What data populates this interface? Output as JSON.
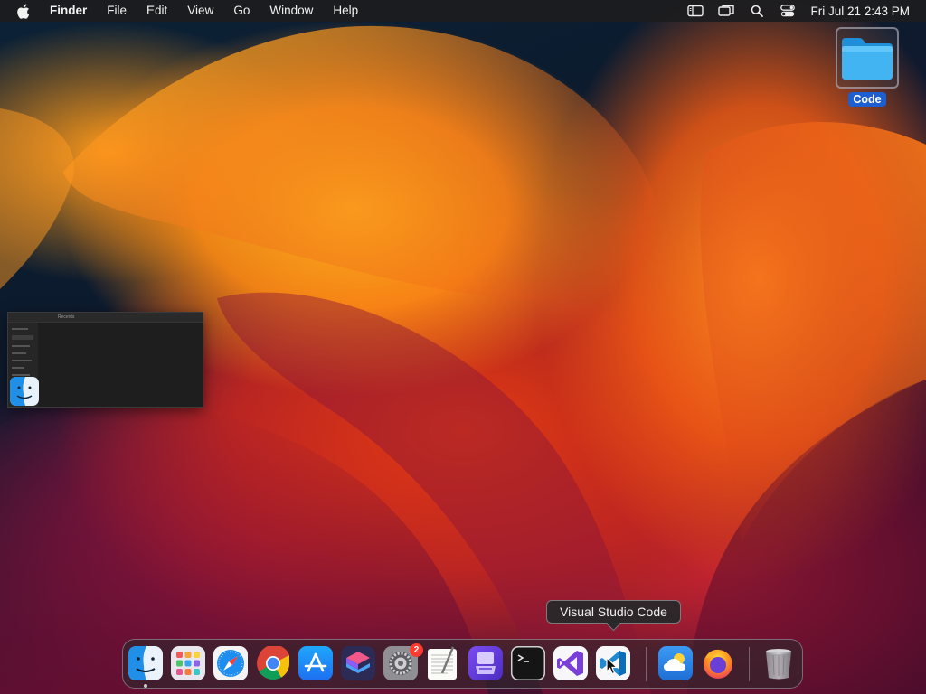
{
  "menubar": {
    "app_name": "Finder",
    "menus": [
      "File",
      "Edit",
      "View",
      "Go",
      "Window",
      "Help"
    ],
    "clock": "Fri Jul 21  2:43 PM",
    "status_icons": [
      "sidebar-icon",
      "screen-mirroring-icon",
      "spotlight-search-icon",
      "control-center-icon"
    ]
  },
  "desktop": {
    "items": [
      {
        "label": "Code",
        "icon": "folder-icon",
        "selected": true
      }
    ]
  },
  "window_thumbnail": {
    "app": "finder",
    "title": "Recents"
  },
  "dock": {
    "tooltip": "Visual Studio Code",
    "apps": [
      {
        "name": "Finder",
        "icon": "finder-icon",
        "running": true
      },
      {
        "name": "Launchpad",
        "icon": "launchpad-icon"
      },
      {
        "name": "Safari",
        "icon": "safari-icon"
      },
      {
        "name": "Google Chrome",
        "icon": "chrome-icon"
      },
      {
        "name": "App Store",
        "icon": "app-store-icon"
      },
      {
        "name": "Shortcuts",
        "icon": "shortcuts-icon"
      },
      {
        "name": "System Settings",
        "icon": "system-settings-icon",
        "badge": "2"
      },
      {
        "name": "TextEdit",
        "icon": "textedit-icon"
      },
      {
        "name": "Simulator",
        "icon": "simulator-icon"
      },
      {
        "name": "Terminal",
        "icon": "terminal-icon"
      },
      {
        "name": "Visual Studio",
        "icon": "visual-studio-icon"
      },
      {
        "name": "Visual Studio Code",
        "icon": "vscode-icon",
        "hovered": true
      },
      {
        "name": "Weather",
        "icon": "weather-icon"
      },
      {
        "name": "Firefox",
        "icon": "firefox-icon"
      },
      {
        "name": "Trash",
        "icon": "trash-icon"
      }
    ]
  },
  "colors": {
    "selection_blue": "#1d5fd1",
    "menubar_bg": "#1c1c1e",
    "badge_red": "#ff3b30"
  }
}
